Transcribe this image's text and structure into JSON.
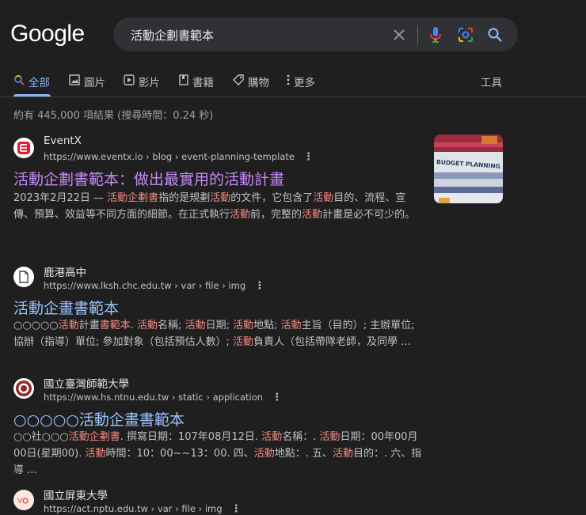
{
  "logo": "Google",
  "search": {
    "query": "活動企劃書範本"
  },
  "tabs": [
    {
      "label": "全部",
      "icon": "search-icon"
    },
    {
      "label": "圖片",
      "icon": "image-icon"
    },
    {
      "label": "影片",
      "icon": "video-icon"
    },
    {
      "label": "書籍",
      "icon": "book-icon"
    },
    {
      "label": "購物",
      "icon": "tag-icon"
    },
    {
      "label": "更多",
      "icon": "kebab-icon"
    }
  ],
  "tools_label": "工具",
  "stats": "約有 445,000 項結果 (搜尋時間：0.24 秒)",
  "results": [
    {
      "site_name": "EventX",
      "url": "https://www.eventx.io › blog › event-planning-template",
      "title": "活動企劃書範本：做出最實用的活動計畫",
      "snippet": [
        {
          "t": "2023年2月22日 — "
        },
        {
          "t": "活動企劃書",
          "h": true
        },
        {
          "t": "指的是規劃"
        },
        {
          "t": "活動",
          "h": true
        },
        {
          "t": "的文件，它包含了"
        },
        {
          "t": "活動",
          "h": true
        },
        {
          "t": "目的、流程、宣傳、預算、效益等不同方面的細節。在正式執行"
        },
        {
          "t": "活動",
          "h": true
        },
        {
          "t": "前，完整的"
        },
        {
          "t": "活動",
          "h": true
        },
        {
          "t": "計畫是必不可少的。"
        }
      ],
      "thumbnail_text": "BUDGET PLANNING"
    },
    {
      "site_name": "鹿港高中",
      "url": "https://www.lksh.chc.edu.tw › var › file › img",
      "title": "活動企畫書範本",
      "snippet": [
        {
          "t": "○○○○○"
        },
        {
          "t": "活動",
          "h": true
        },
        {
          "t": "計畫"
        },
        {
          "t": "書範本",
          "h": true
        },
        {
          "t": ". "
        },
        {
          "t": "活動",
          "h": true
        },
        {
          "t": "名稱; "
        },
        {
          "t": "活動",
          "h": true
        },
        {
          "t": "日期; "
        },
        {
          "t": "活動",
          "h": true
        },
        {
          "t": "地點; "
        },
        {
          "t": "活動",
          "h": true
        },
        {
          "t": "主旨（目的）; 主辦單位; 協辦（指導）單位; 參加對象（包括預估人數）; "
        },
        {
          "t": "活動",
          "h": true
        },
        {
          "t": "負責人（包括帶隊老師，及同學 ..."
        }
      ]
    },
    {
      "site_name": "國立臺灣師範大學",
      "url": "https://www.hs.ntnu.edu.tw › static › application",
      "title": "○○○○○活動企畫書範本",
      "snippet": [
        {
          "t": "○○社○○○"
        },
        {
          "t": "活動企劃書",
          "h": true
        },
        {
          "t": ". 撰寫日期：107年08月12日. "
        },
        {
          "t": "活動",
          "h": true
        },
        {
          "t": "名稱：. "
        },
        {
          "t": "活動",
          "h": true
        },
        {
          "t": "日期：00年00月00日(星期00). "
        },
        {
          "t": "活動",
          "h": true
        },
        {
          "t": "時間：10：00~~13：00. 四、"
        },
        {
          "t": "活動",
          "h": true
        },
        {
          "t": "地點：. 五、"
        },
        {
          "t": "活動",
          "h": true
        },
        {
          "t": "目的：. 六、指導 ..."
        }
      ]
    },
    {
      "site_name": "國立屏東大學",
      "url": "https://act.nptu.edu.tw › var › file › img"
    }
  ]
}
